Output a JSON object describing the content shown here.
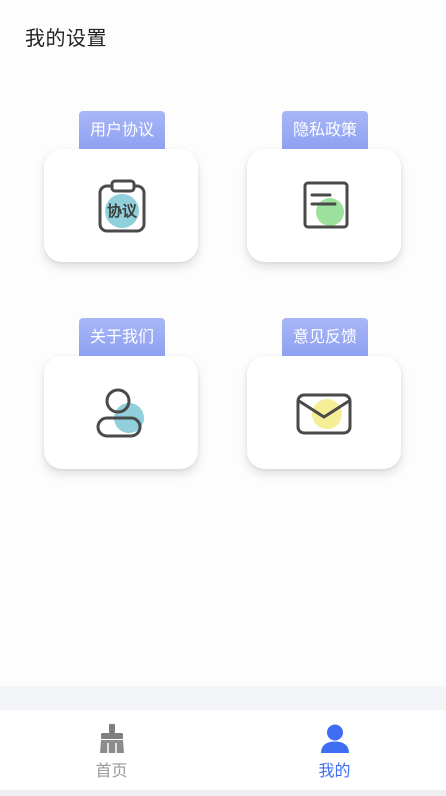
{
  "header": {
    "title": "我的设置"
  },
  "cards": [
    {
      "tag": "用户协议",
      "icon": "clipboard-agreement-icon",
      "icon_text": "协议",
      "accent": "#8fd0dc"
    },
    {
      "tag": "隐私政策",
      "icon": "document-privacy-icon",
      "accent": "#9ce29c"
    },
    {
      "tag": "关于我们",
      "icon": "user-icon",
      "accent": "#8fd0dc"
    },
    {
      "tag": "意见反馈",
      "icon": "envelope-icon",
      "accent": "#f6ee96"
    }
  ],
  "tabbar": {
    "home": {
      "label": "首页",
      "icon": "broom-icon",
      "color": "#9a9a9a"
    },
    "mine": {
      "label": "我的",
      "icon": "user-solid-icon",
      "color": "#3f6ef3",
      "active": true
    }
  },
  "colors": {
    "tag_bg": "#9aa9f4",
    "active": "#3f6ef3"
  }
}
